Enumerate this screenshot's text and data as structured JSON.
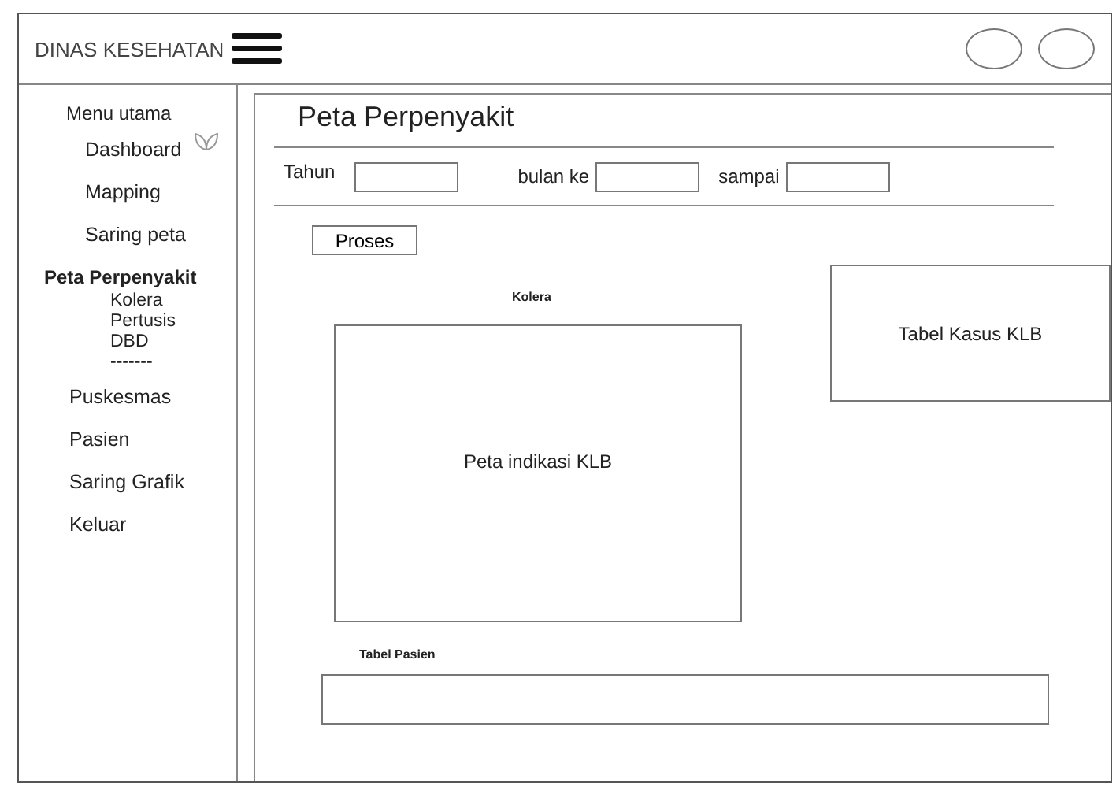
{
  "header": {
    "title": "DINAS KESEHATAN"
  },
  "sidebar": {
    "heading": "Menu utama",
    "items": [
      {
        "label": "Dashboard",
        "selected": false
      },
      {
        "label": "Mapping",
        "selected": false
      },
      {
        "label": "Saring peta",
        "selected": false
      },
      {
        "label": "Peta Perpenyakit",
        "selected": true,
        "children": [
          {
            "label": "Kolera"
          },
          {
            "label": "Pertusis"
          },
          {
            "label": "DBD"
          },
          {
            "label": "-------"
          }
        ]
      },
      {
        "label": "Puskesmas",
        "selected": false
      },
      {
        "label": "Pasien",
        "selected": false
      },
      {
        "label": "Saring Grafik",
        "selected": false
      },
      {
        "label": "Keluar",
        "selected": false
      }
    ]
  },
  "main": {
    "title": "Peta Perpenyakit",
    "filters": [
      {
        "label": "Tahun"
      },
      {
        "label": "bulan ke"
      },
      {
        "label": "sampai"
      }
    ],
    "process_button": "Proses",
    "map_caption": "Kolera",
    "map_placeholder": "Peta indikasi KLB",
    "case_table_placeholder": "Tabel Kasus KLB",
    "patient_table_label": "Tabel Pasien"
  }
}
